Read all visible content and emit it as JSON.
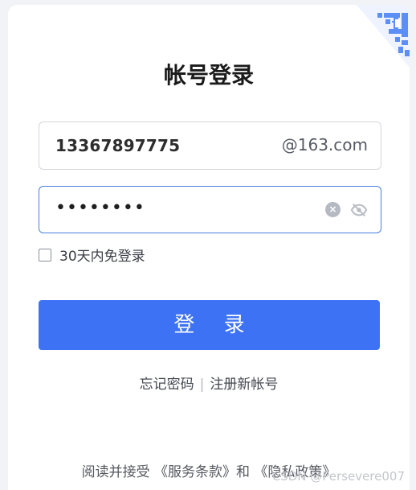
{
  "title": "帐号登录",
  "account": {
    "value": "13367897775",
    "suffix": "@163.com"
  },
  "password": {
    "masked_value": "••••••••",
    "clear_icon": "clear-icon",
    "toggle_icon": "eye-off-icon"
  },
  "remember": {
    "label": "30天内免登录",
    "checked": false
  },
  "login_button": "登 录",
  "links": {
    "forgot": "忘记密码",
    "separator": "|",
    "register": "注册新帐号"
  },
  "agreement": {
    "prefix": "阅读并接受",
    "terms": "《服务条款》",
    "conjunction": "和",
    "privacy": "《隐私政策》"
  },
  "watermark": "CSDN @Persevere007",
  "colors": {
    "accent": "#3d72f5",
    "focus_border": "#4b7fe0"
  }
}
